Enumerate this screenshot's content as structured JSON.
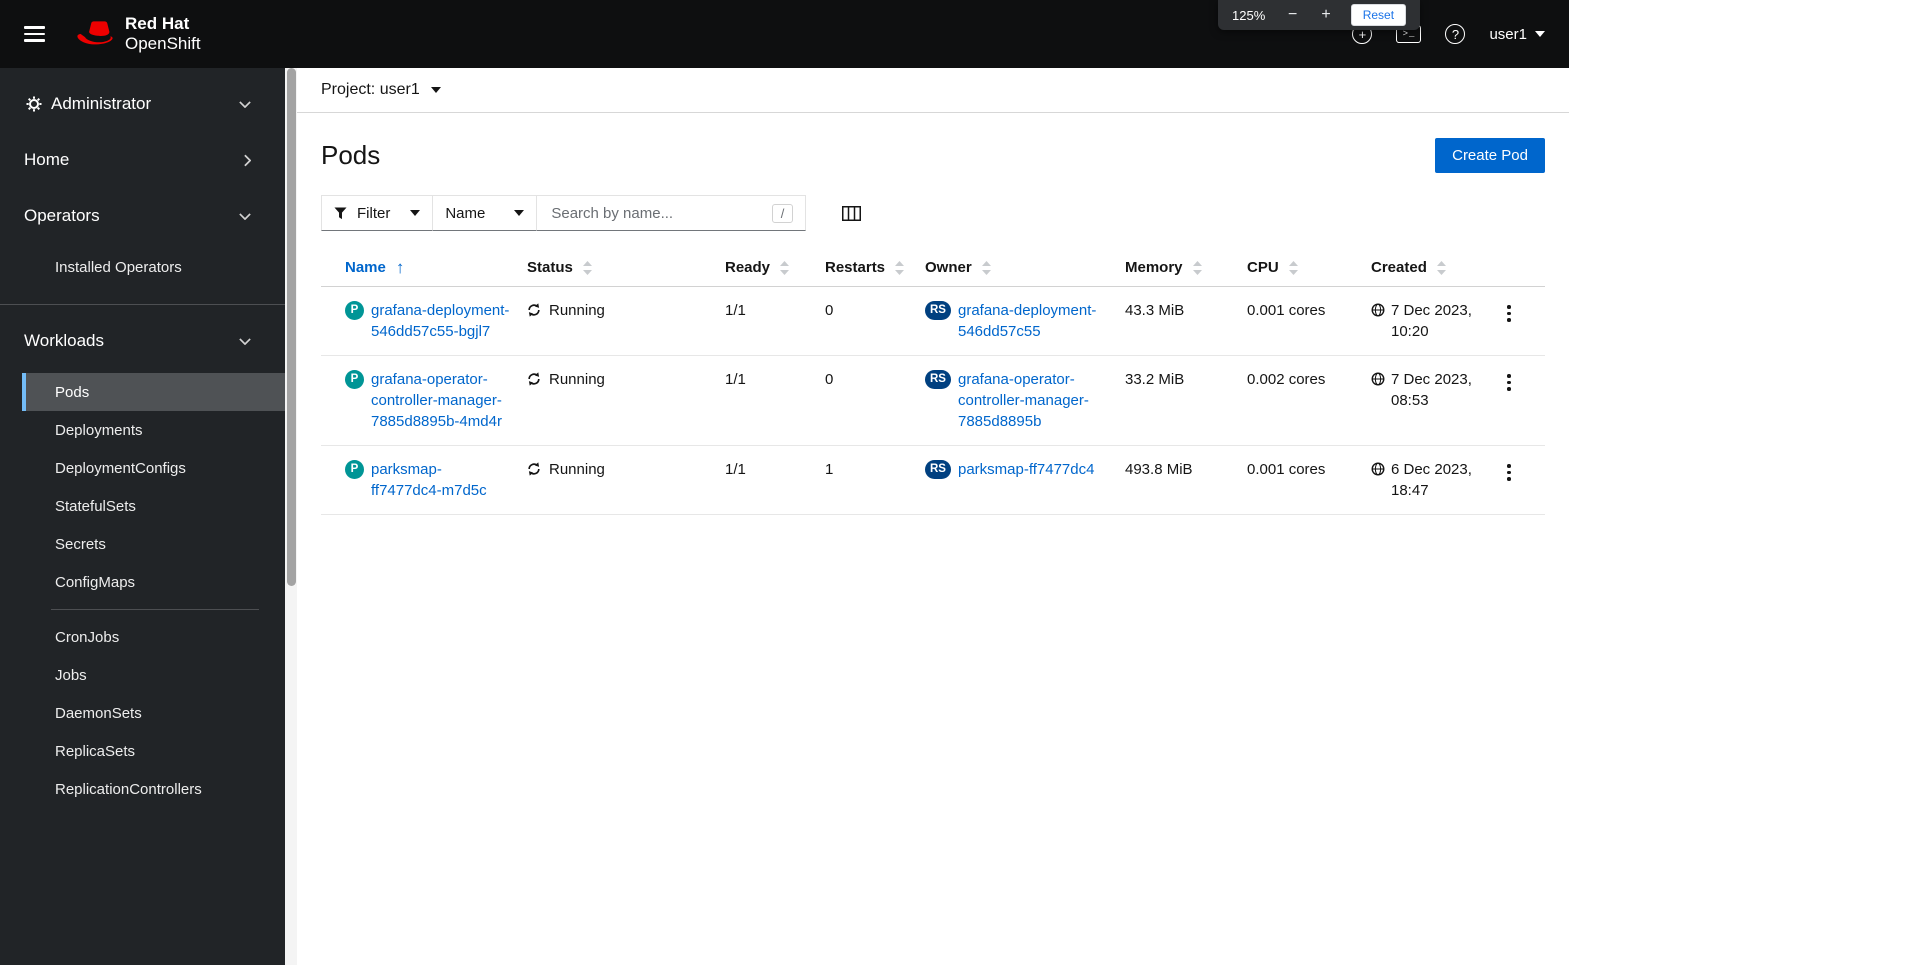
{
  "browser_zoom": {
    "level": "125%",
    "minus": "−",
    "plus": "+",
    "reset": "Reset"
  },
  "masthead": {
    "brand": {
      "line1": "Red Hat",
      "line2": "OpenShift"
    },
    "icons": {
      "plus": "+",
      "terminal": "&gt;_",
      "terminal_glyph": ">_",
      "help": "?"
    },
    "user": "user1"
  },
  "sidebar": {
    "perspective": "Administrator",
    "nav": [
      {
        "label": "Home"
      },
      {
        "label": "Operators",
        "items": [
          "Installed Operators"
        ]
      },
      {
        "label": "Workloads",
        "selected_item": "Pods",
        "items": [
          "Pods",
          "Deployments",
          "DeploymentConfigs",
          "StatefulSets",
          "Secrets",
          "ConfigMaps",
          "CronJobs",
          "Jobs",
          "DaemonSets",
          "ReplicaSets",
          "ReplicationControllers"
        ]
      }
    ]
  },
  "project_bar": {
    "label": "Project: user1"
  },
  "page": {
    "title": "Pods",
    "create_button": "Create Pod"
  },
  "toolbar": {
    "filter": "Filter",
    "attribute": "Name",
    "search_placeholder": "Search by name...",
    "shortcut_key": "/"
  },
  "table": {
    "columns": [
      "Name",
      "Status",
      "Ready",
      "Restarts",
      "Owner",
      "Memory",
      "CPU",
      "Created"
    ],
    "sorted_by": "Name",
    "sort_arrow": "↑",
    "rows": [
      {
        "badge": "P",
        "name": "grafana-deployment-546dd57c55-bgjl7",
        "status": "Running",
        "ready": "1/1",
        "restarts": "0",
        "owner_badge": "RS",
        "owner": "grafana-deployment-546dd57c55",
        "memory": "43.3 MiB",
        "cpu": "0.001 cores",
        "created": "7 Dec 2023, 10:20"
      },
      {
        "badge": "P",
        "name": "grafana-operator-controller-manager-7885d8895b-4md4r",
        "status": "Running",
        "ready": "1/1",
        "restarts": "0",
        "owner_badge": "RS",
        "owner": "grafana-operator-controller-manager-7885d8895b",
        "memory": "33.2 MiB",
        "cpu": "0.002 cores",
        "created": "7 Dec 2023, 08:53"
      },
      {
        "badge": "P",
        "name": "parksmap-ff7477dc4-m7d5c",
        "status": "Running",
        "ready": "1/1",
        "restarts": "1",
        "owner_badge": "RS",
        "owner": "parksmap-ff7477dc4",
        "memory": "493.8 MiB",
        "cpu": "0.001 cores",
        "created": "6 Dec 2023, 18:47"
      }
    ]
  },
  "colors": {
    "accent": "#0066cc",
    "pod_badge": "#009596",
    "replicaset_badge": "#004080",
    "masthead_bg": "#0e0f10",
    "sidebar_bg": "#212427",
    "selected_nav_bg": "#4f5255",
    "selected_nav_border": "#73bcf7"
  }
}
